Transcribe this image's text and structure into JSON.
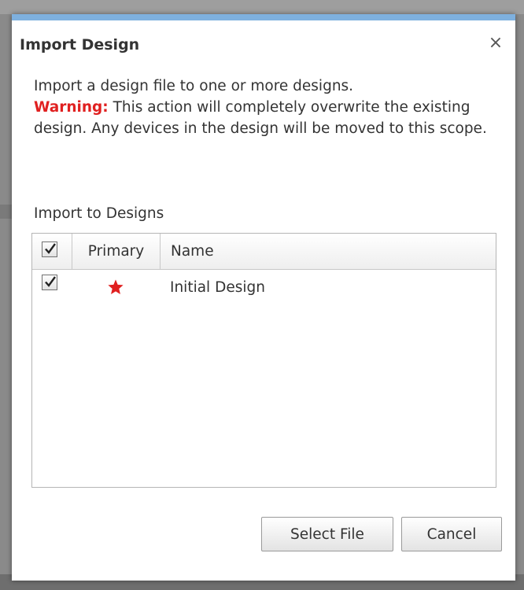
{
  "dialog": {
    "title": "Import Design",
    "close_glyph": "×",
    "message": {
      "intro": "Import a design file to one or more designs.",
      "warning_label": "Warning:",
      "warning_text": "This action will completely overwrite the existing design. Any devices in the design will be moved to this scope."
    },
    "section_label": "Import to Designs",
    "grid": {
      "columns": {
        "select_all_checked": true,
        "primary": "Primary",
        "name": "Name"
      },
      "rows": [
        {
          "checked": true,
          "primary": true,
          "primary_icon": "star-icon",
          "name": "Initial Design"
        }
      ]
    },
    "buttons": {
      "select_file": "Select File",
      "cancel": "Cancel"
    }
  },
  "colors": {
    "accent": "#7eb0de",
    "warning": "#e02020",
    "star": "#e02020"
  }
}
